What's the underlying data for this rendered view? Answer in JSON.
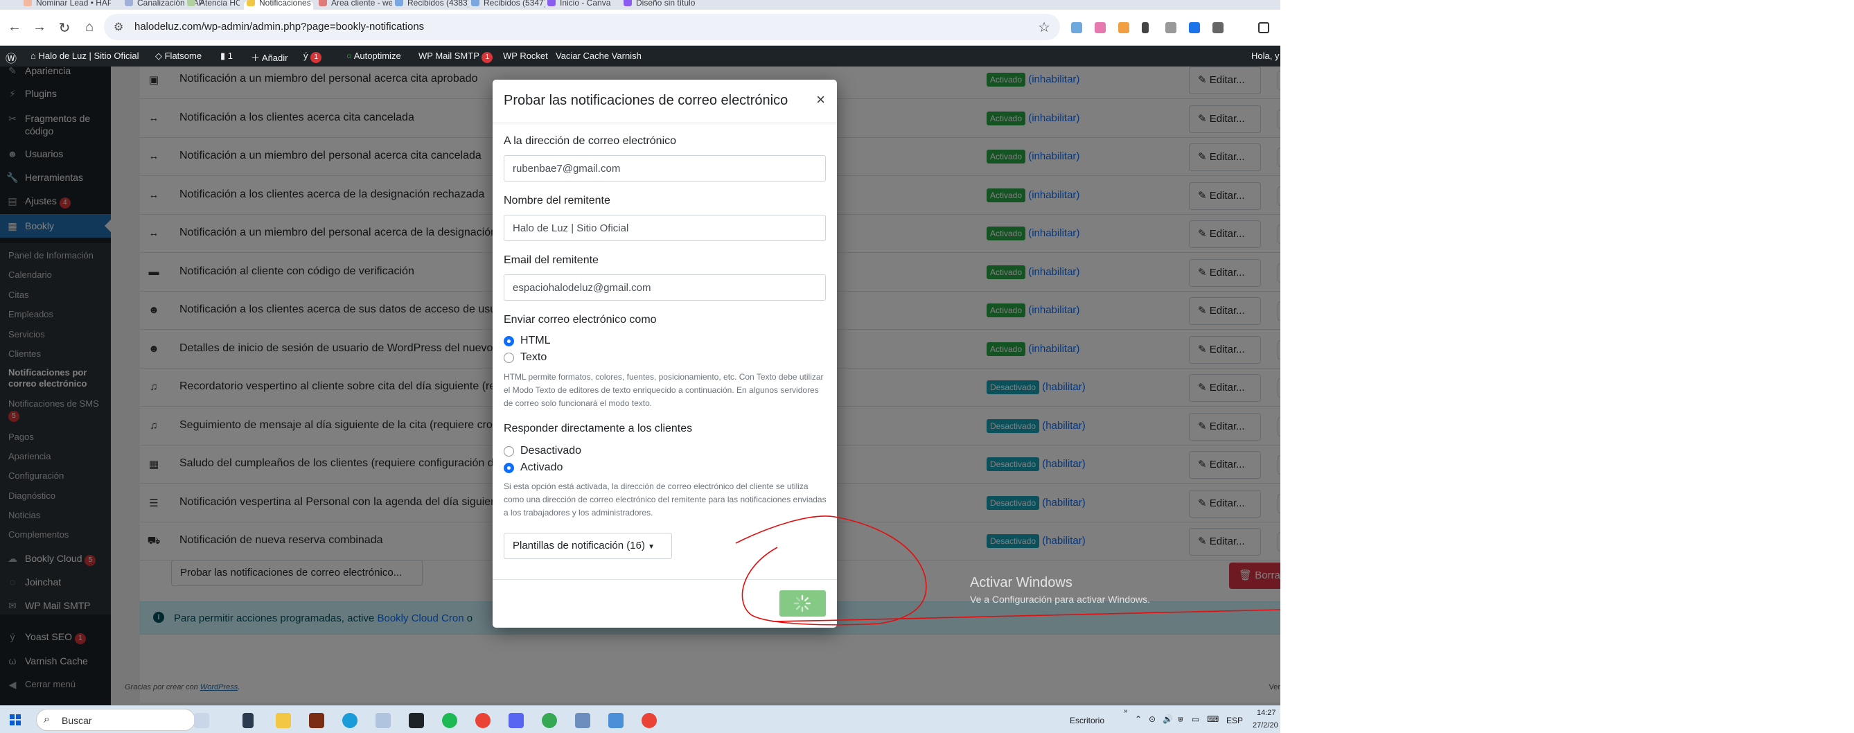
{
  "browser": {
    "tabs": [
      {
        "label": "Nominar Lead • HAP"
      },
      {
        "label": "Canalización HAP"
      },
      {
        "label": "Atencia HOLD"
      },
      {
        "label": "Notificaciones por c..."
      },
      {
        "label": "Área cliente - web"
      },
      {
        "label": "Recibidos (4383)"
      },
      {
        "label": "Recibidos (5347)"
      },
      {
        "label": "Inicio - Canva"
      },
      {
        "label": "Diseño sin título"
      }
    ],
    "url": "halodeluz.com/wp-admin/admin.php?page=bookly-notifications"
  },
  "adminbar": {
    "site": "Halo de Luz | Sitio Oficial",
    "theme": "Flatsome",
    "comments": "1",
    "add_new": "Añadir",
    "updates": "1",
    "autoptimize": "Autoptimize",
    "wpmail": "WP Mail SMTP",
    "wpmail_count": "1",
    "rocket": "WP Rocket",
    "varnish": "Vaciar Cache Varnish",
    "greeting": "Hola, y"
  },
  "sidebar": {
    "items": [
      {
        "label": "Apariencia",
        "icon": "paint-brush-icon"
      },
      {
        "label": "Plugins",
        "icon": "plug-icon"
      },
      {
        "label": "Fragmentos de código",
        "icon": "scissors-icon"
      },
      {
        "label": "Usuarios",
        "icon": "user-icon"
      },
      {
        "label": "Herramientas",
        "icon": "wrench-icon"
      },
      {
        "label": "Ajustes",
        "icon": "sliders-icon",
        "count": "4"
      },
      {
        "label": "Bookly",
        "icon": "bookly-icon"
      }
    ],
    "submenu": [
      {
        "label": "Panel de Información"
      },
      {
        "label": "Calendario"
      },
      {
        "label": "Citas"
      },
      {
        "label": "Empleados"
      },
      {
        "label": "Servicios"
      },
      {
        "label": "Clientes"
      },
      {
        "label": "Notificaciones por correo electrónico"
      },
      {
        "label": "Notificaciones de SMS",
        "count": "5"
      },
      {
        "label": "Pagos"
      },
      {
        "label": "Apariencia"
      },
      {
        "label": "Configuración"
      },
      {
        "label": "Diagnóstico"
      },
      {
        "label": "Noticias"
      },
      {
        "label": "Complementos"
      }
    ],
    "after": [
      {
        "label": "Bookly Cloud",
        "count": "5"
      },
      {
        "label": "Joinchat"
      },
      {
        "label": "WP Mail SMTP"
      },
      {
        "label": "Yoast SEO",
        "count": "1"
      },
      {
        "label": "Varnish Cache"
      },
      {
        "label": "Cerrar menú"
      }
    ]
  },
  "notifications": {
    "rows": [
      {
        "icon": "calendar-check-icon",
        "name": "Notificación a un miembro del personal acerca cita aprobado",
        "status": "Activado",
        "toggle": "(inhabilitar)",
        "edit": "Editar..."
      },
      {
        "icon": "arrows-h-icon",
        "name": "Notificación a los clientes acerca cita cancelada",
        "status": "Activado",
        "toggle": "(inhabilitar)",
        "edit": "Editar..."
      },
      {
        "icon": "arrows-h-icon",
        "name": "Notificación a un miembro del personal acerca cita cancelada",
        "status": "Activado",
        "toggle": "(inhabilitar)",
        "edit": "Editar..."
      },
      {
        "icon": "arrows-h-icon",
        "name": "Notificación a los clientes acerca de la designación rechazada",
        "status": "Activado",
        "toggle": "(inhabilitar)",
        "edit": "Editar..."
      },
      {
        "icon": "arrows-h-icon",
        "name": "Notificación a un miembro del personal acerca de la designación rechazada",
        "status": "Activado",
        "toggle": "(inhabilitar)",
        "edit": "Editar..."
      },
      {
        "icon": "id-card-icon",
        "name": "Notificación al cliente con código de verificación",
        "status": "Activado",
        "toggle": "(inhabilitar)",
        "edit": "Editar..."
      },
      {
        "icon": "user-plus-icon",
        "name": "Notificación a los clientes acerca de sus datos de acceso de usuario",
        "status": "Activado",
        "toggle": "(inhabilitar)",
        "edit": "Editar..."
      },
      {
        "icon": "user-plus-icon",
        "name": "Detalles de inicio de sesión de usuario de WordPress del nuevo cliente",
        "status": "Activado",
        "toggle": "(inhabilitar)",
        "edit": "Editar..."
      },
      {
        "icon": "bell-icon",
        "name": "Recordatorio vespertino al cliente sobre cita del día siguiente (requiere cron)",
        "status": "Desactivado",
        "toggle": "(habilitar)",
        "edit": "Editar..."
      },
      {
        "icon": "bell-icon",
        "name": "Seguimiento de mensaje al día siguiente de la cita (requiere cron)",
        "status": "Desactivado",
        "toggle": "(habilitar)",
        "edit": "Editar..."
      },
      {
        "icon": "gift-icon",
        "name": "Saludo del cumpleaños de los clientes (requiere configuración de cron)",
        "status": "Desactivado",
        "toggle": "(habilitar)",
        "edit": "Editar..."
      },
      {
        "icon": "list-icon",
        "name": "Notificación vespertina al Personal con la agenda del día siguiente",
        "status": "Desactivado",
        "toggle": "(habilitar)",
        "edit": "Editar..."
      },
      {
        "icon": "cart-icon",
        "name": "Notificación de nueva reserva combinada",
        "status": "Desactivado",
        "toggle": "(habilitar)",
        "edit": "Editar..."
      }
    ],
    "test_button": "Probar las notificaciones de correo electrónico...",
    "delete_button": "Borrar",
    "info_text": "Para permitir acciones programadas, active",
    "info_link": "Bookly Cloud Cron",
    "info_tail": "o"
  },
  "footer": {
    "thanks": "Gracias por crear con",
    "wp_link": "WordPress",
    "version": "Ver"
  },
  "watermark": {
    "line1": "Activar Windows",
    "line2": "Ve a Configuración para activar Windows."
  },
  "modal": {
    "title": "Probar las notificaciones de correo electrónico",
    "to_label": "A la dirección de correo electrónico",
    "to_value": "rubenbae7@gmail.com",
    "sender_name_label": "Nombre del remitente",
    "sender_name_value": "Halo de Luz | Sitio Oficial",
    "sender_email_label": "Email del remitente",
    "sender_email_value": "espaciohalodeluz@gmail.com",
    "send_as_label": "Enviar correo electrónico como",
    "send_as_html": "HTML",
    "send_as_text": "Texto",
    "send_as_help": "HTML permite formatos, colores, fuentes, posicionamiento, etc. Con Texto debe utilizar el Modo Texto de editores de texto enriquecido a continuación. En algunos servidores de correo solo funcionará el modo texto.",
    "reply_label": "Responder directamente a los clientes",
    "reply_off": "Desactivado",
    "reply_on": "Activado",
    "reply_help": "Si esta opción está activada, la dirección de correo electrónico del cliente se utiliza como una dirección de correo electrónico del remitente para las notificaciones enviadas a los trabajadores y los administradores.",
    "templates_button": "Plantillas de notificación (16)",
    "send_as_selected": "HTML",
    "reply_selected": "Activado"
  },
  "taskbar": {
    "search": "Buscar",
    "desktop": "Escritorio",
    "lang": "ESP",
    "time": "14:27",
    "date": "27/2/20"
  },
  "colors": {
    "accent": "#2271b1",
    "success": "#28a745",
    "info": "#17a2b8",
    "danger": "#dc3545",
    "annotation": "#e01010"
  }
}
